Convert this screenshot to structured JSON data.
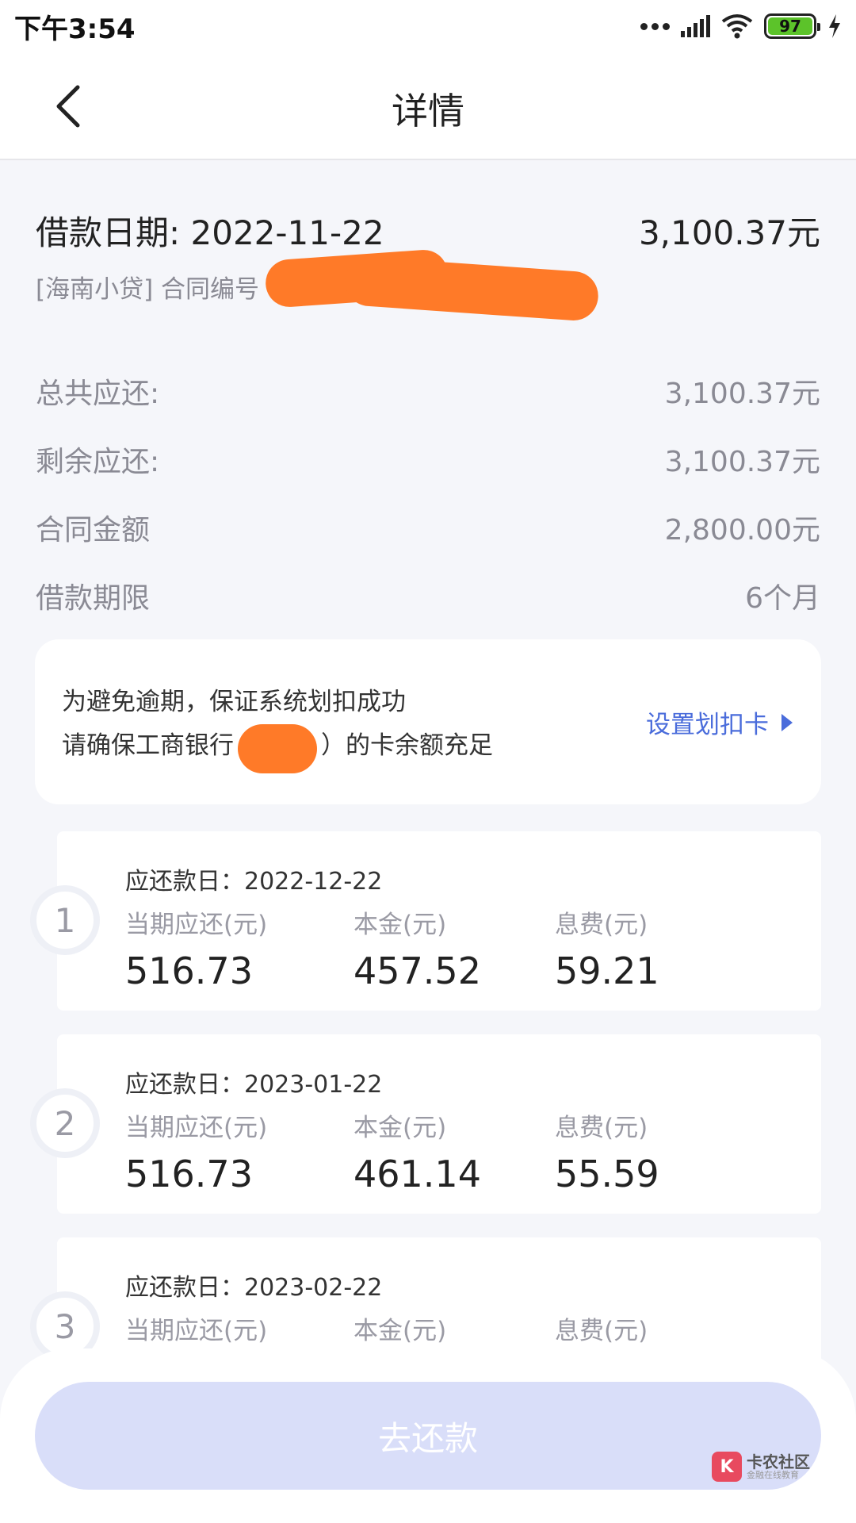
{
  "status_bar": {
    "time": "下午3:54",
    "battery": "97"
  },
  "nav": {
    "title": "详情"
  },
  "summary": {
    "loan_date_label": "借款日期: 2022-11-22",
    "loan_amount": "3,100.37元",
    "contract_prefix": "[海南小贷] 合同编号"
  },
  "info_rows": [
    {
      "label": "总共应还:",
      "value": "3,100.37元"
    },
    {
      "label": "剩余应还:",
      "value": "3,100.37元"
    },
    {
      "label": "合同金额",
      "value": "2,800.00元"
    },
    {
      "label": "借款期限",
      "value": "6个月"
    }
  ],
  "notice": {
    "line1": "为避免逾期，保证系统划扣成功",
    "line2_prefix": "请确保工商银行",
    "line2_suffix": "）的卡余额充足",
    "link_label": "设置划扣卡"
  },
  "installment_labels": {
    "due": "当期应还(元)",
    "principal": "本金(元)",
    "interest": "息费(元)"
  },
  "installments": [
    {
      "index": "1",
      "date": "应还款日：2022-12-22",
      "due": "516.73",
      "principal": "457.52",
      "interest": "59.21"
    },
    {
      "index": "2",
      "date": "应还款日：2023-01-22",
      "due": "516.73",
      "principal": "461.14",
      "interest": "55.59"
    },
    {
      "index": "3",
      "date": "应还款日：2023-02-22",
      "due": "",
      "principal": "",
      "interest": ""
    }
  ],
  "actions": {
    "pay_label": "去还款"
  },
  "watermark": {
    "title": "卡农社区",
    "subtitle": "金融在线教育"
  },
  "colors": {
    "accent": "#4a6cdb",
    "button_disabled": "#d9def9",
    "redaction": "#ff7a28"
  }
}
